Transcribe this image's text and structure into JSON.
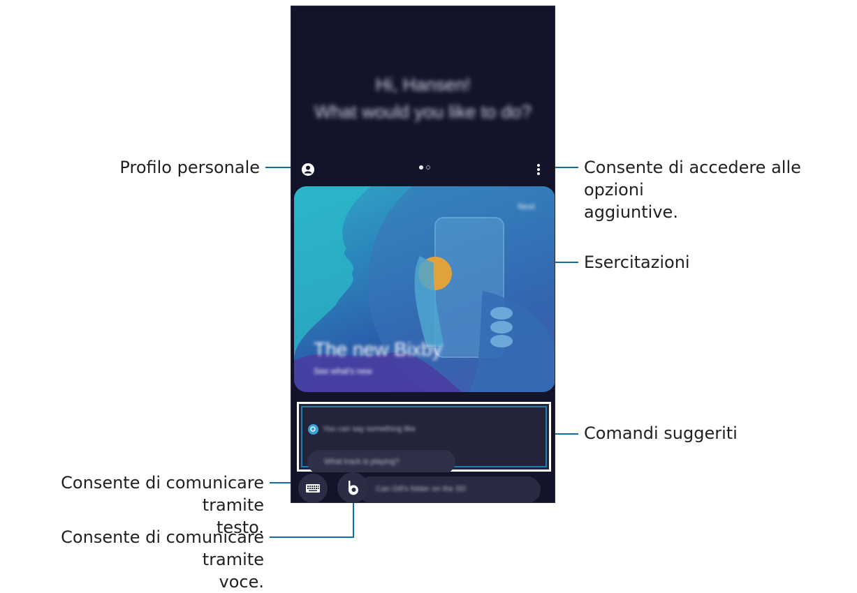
{
  "callouts": {
    "profile": "Profilo personale",
    "options_line1": "Consente di accedere alle opzioni",
    "options_line2": "aggiuntive.",
    "tutorials": "Esercitazioni",
    "suggested": "Comandi suggeriti",
    "text_line1": "Consente di comunicare tramite",
    "text_line2": "testo.",
    "voice_line1": "Consente di comunicare tramite",
    "voice_line2": "voce."
  },
  "screen": {
    "greeting_line1": "Hi, Hansen!",
    "greeting_line2": "What would you like to do?",
    "card_next": "Next",
    "card_title": "The new Bixby",
    "card_subtitle": "See what's new",
    "suggest_header": "You can say something like",
    "suggest_chip": "What track is playing?",
    "bottom_chip": "Can Gill's folder on the SD"
  },
  "icons": {
    "profile": "profile-icon",
    "more": "more-options-icon",
    "keyboard": "keyboard-icon",
    "bixby": "bixby-voice-icon",
    "search": "search-bubble-icon"
  },
  "colors": {
    "leader_line": "#0f6ea3",
    "phone_bg": "#13132a",
    "highlight_box": "#1d7fb4"
  }
}
